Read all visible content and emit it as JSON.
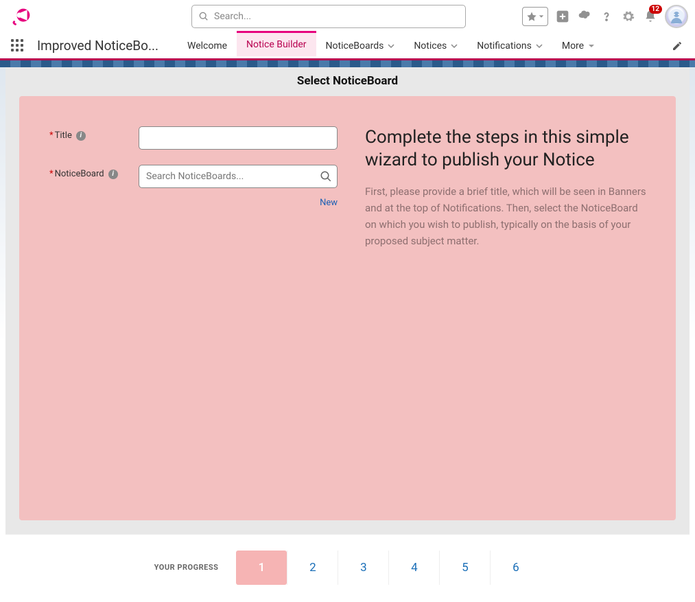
{
  "header": {
    "search_placeholder": "Search...",
    "notification_count": "12"
  },
  "nav": {
    "app_name": "Improved NoticeBo...",
    "tabs": [
      {
        "label": "Welcome",
        "has_dropdown": false,
        "active": false
      },
      {
        "label": "Notice Builder",
        "has_dropdown": false,
        "active": true
      },
      {
        "label": "NoticeBoards",
        "has_dropdown": true,
        "active": false
      },
      {
        "label": "Notices",
        "has_dropdown": true,
        "active": false
      },
      {
        "label": "Notifications",
        "has_dropdown": true,
        "active": false
      },
      {
        "label": "More",
        "has_dropdown": true,
        "active": false
      }
    ]
  },
  "panel": {
    "title": "Select NoticeBoard",
    "form": {
      "title_label": "Title",
      "noticeboard_label": "NoticeBoard",
      "noticeboard_placeholder": "Search NoticeBoards...",
      "new_link": "New"
    },
    "help": {
      "heading": "Complete the steps in this simple wizard to publish your Notice",
      "body": "First, please provide a brief title, which will be seen in Banners and at the top of Notifications. Then, select the NoticeBoard on which you wish to publish, typically on the basis of your proposed subject matter."
    }
  },
  "progress": {
    "label": "YOUR PROGRESS",
    "steps": [
      "1",
      "2",
      "3",
      "4",
      "5",
      "6"
    ],
    "active_index": 0
  }
}
